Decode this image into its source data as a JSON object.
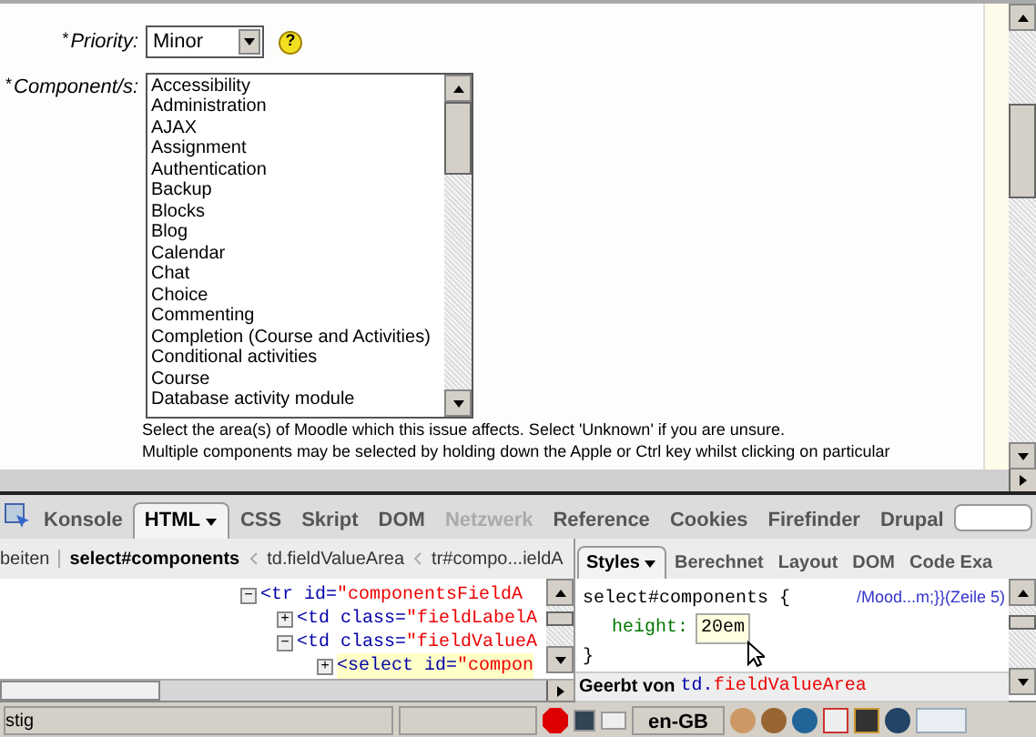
{
  "page": {
    "priority": {
      "mark": "*",
      "label": "Priority:",
      "value": "Minor",
      "help_icon": "?"
    },
    "components": {
      "mark": "*",
      "label": "Component/s:",
      "options": [
        "Accessibility",
        "Administration",
        "AJAX",
        "Assignment",
        "Authentication",
        "Backup",
        "Blocks",
        "Blog",
        "Calendar",
        "Chat",
        "Choice",
        "Commenting",
        "Completion (Course and Activities)",
        "Conditional activities",
        "Course",
        "Database activity module"
      ]
    },
    "help": [
      "Select the area(s) of Moodle which this issue affects. Select 'Unknown' if you are unsure.",
      "Multiple components may be selected by holding down the Apple or Ctrl key whilst clicking on particular"
    ]
  },
  "devtools": {
    "tabs": [
      {
        "label": "Konsole",
        "selected": false,
        "disabled": false
      },
      {
        "label": "HTML",
        "selected": true,
        "disabled": false
      },
      {
        "label": "CSS",
        "selected": false,
        "disabled": false
      },
      {
        "label": "Skript",
        "selected": false,
        "disabled": false
      },
      {
        "label": "DOM",
        "selected": false,
        "disabled": false
      },
      {
        "label": "Netzwerk",
        "selected": false,
        "disabled": true
      },
      {
        "label": "Reference",
        "selected": false,
        "disabled": false
      },
      {
        "label": "Cookies",
        "selected": false,
        "disabled": false
      },
      {
        "label": "Firefinder",
        "selected": false,
        "disabled": false
      },
      {
        "label": "Drupal",
        "selected": false,
        "disabled": false
      }
    ],
    "breadcrumbs": [
      {
        "label": "beiten",
        "selected": false
      },
      {
        "label": "select#components",
        "selected": true
      },
      {
        "label": "td.fieldValueArea",
        "selected": false
      },
      {
        "label": "tr#compo...ieldA",
        "selected": false
      }
    ],
    "html_lines": [
      {
        "toggle": "−",
        "open": "<tr id=",
        "value": "\"componentsFieldA",
        "highlighted": false
      },
      {
        "toggle": "+",
        "open": "<td class=",
        "value": "\"fieldLabelA",
        "highlighted": false
      },
      {
        "toggle": "−",
        "open": "<td class=",
        "value": "\"fieldValueA",
        "highlighted": false
      },
      {
        "toggle": "+",
        "open": "<select id=",
        "value": "\"compon",
        "highlighted": true
      }
    ],
    "side_tabs": [
      {
        "label": "Styles",
        "selected": true
      },
      {
        "label": "Berechnet",
        "selected": false
      },
      {
        "label": "Layout",
        "selected": false
      },
      {
        "label": "DOM",
        "selected": false
      },
      {
        "label": "Code Exa",
        "selected": false
      }
    ],
    "rule": {
      "selector": "select#components {",
      "source": "/Mood...m;}}(Zeile 5)",
      "property": "height:",
      "value": "20em",
      "close": "}"
    },
    "inherited_label": "Geerbt von",
    "inherited_from": "td.",
    "inherited_class": "fieldValueArea"
  },
  "status_bar": {
    "text": "stig",
    "language": "en-GB"
  }
}
